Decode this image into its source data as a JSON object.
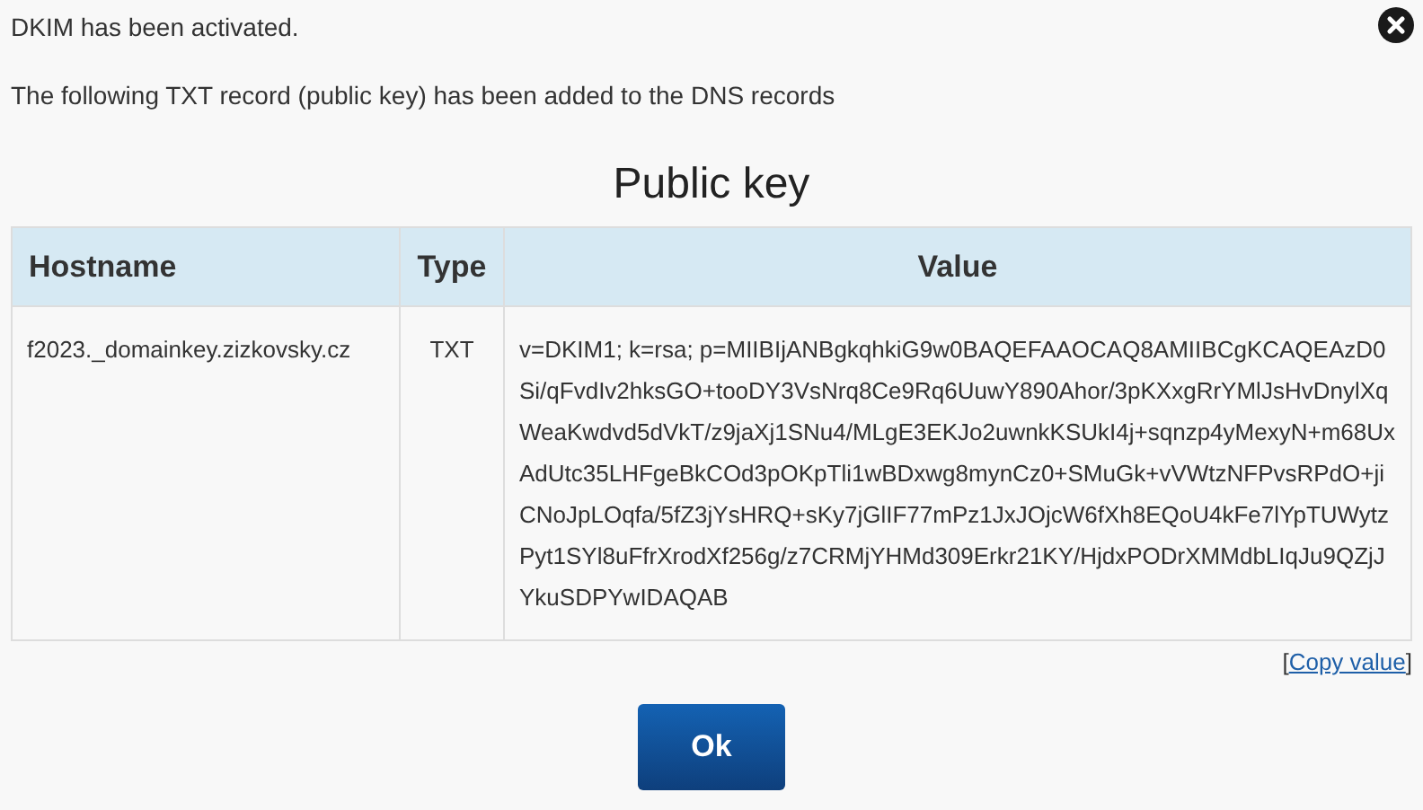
{
  "messages": [
    "DKIM has been activated.",
    "The following TXT record (public key) has been added to the DNS records"
  ],
  "title": "Public key",
  "table": {
    "columns": [
      "Hostname",
      "Type",
      "Value"
    ],
    "rows": [
      [
        "f2023._domainkey.zizkovsky.cz",
        "TXT",
        "v=DKIM1; k=rsa; p=MIIBIjANBgkqhkiG9w0BAQEFAAOCAQ8AMIIBCgKCAQEAzD0Si/qFvdIv2hksGO+tooDY3VsNrq8Ce9Rq6UuwY890Ahor/3pKXxgRrYMlJsHvDnylXqWeaKwdvd5dVkT/z9jaXj1SNu4/MLgE3EKJo2uwnkKSUkI4j+sqnzp4yMexyN+m68UxAdUtc35LHFgeBkCOd3pOKpTli1wBDxwg8mynCz0+SMuGk+vVWtzNFPvsRPdO+jiCNoJpLOqfa/5fZ3jYsHRQ+sKy7jGlIF77mPz1JxJOjcW6fXh8EQoU4kFe7lYpTUWytzPyt1SYl8uFfrXrodXf256g/z7CRMjYHMd309Erkr21KY/HjdxPODrXMMdbLIqJu9QZjJYkuSDPYwIDAQAB"
      ]
    ]
  },
  "copy": {
    "open": "[",
    "label": "Copy value",
    "close": "]"
  },
  "button": "Ok"
}
